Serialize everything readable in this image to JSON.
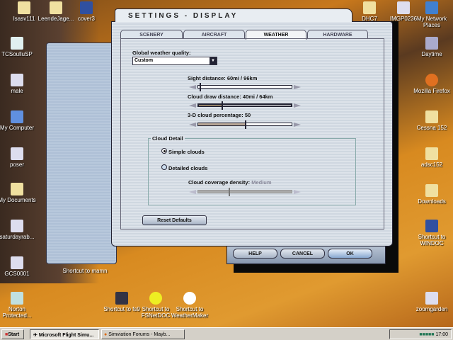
{
  "desktop": {
    "icons_left": [
      "Isasv111",
      "LeendeJage...",
      "cover3",
      "TCSoulluSP",
      "male",
      "My Computer",
      "poser",
      "My Documents",
      "saturdayrab...",
      "GCS0001",
      "Norton Protected..."
    ],
    "icons_bottom": [
      "Shortcut to fs9",
      "Shortcut to FSNetDOC",
      "Shortcut to WeatherMaker",
      "Shortcut to mamn"
    ],
    "icons_right": [
      "DHC7",
      "IMGP0236",
      "My Network Places",
      "Daytime",
      "Mozilla Firefox",
      "Cessna 152",
      "adsc152",
      "Downloads",
      "Shortcut to WINDOC",
      "zoomgarden"
    ]
  },
  "dialog": {
    "title": "SETTINGS - DISPLAY",
    "tabs": [
      {
        "label": "SCENERY"
      },
      {
        "label": "AIRCRAFT"
      },
      {
        "label": "WEATHER",
        "active": true
      },
      {
        "label": "HARDWARE"
      }
    ],
    "global_quality_label": "Global weather quality:",
    "global_quality_value": "Custom",
    "sight_label": "Sight distance: 60mi / 96km",
    "sight_value_pct": 2,
    "cloud_draw_label": "Cloud draw distance: 40mi / 64km",
    "cloud_draw_value_pct": 25,
    "cloud_pct_label": "3-D cloud percentage: 50",
    "cloud_pct_value": 50,
    "group_title": "Cloud Detail",
    "simple_clouds": "Simple clouds",
    "detailed_clouds": "Detailed clouds",
    "selected": "simple",
    "density_label": "Cloud coverage density:",
    "density_value": "Medium",
    "density_value_pct": 33,
    "reset": "Reset Defaults",
    "help": "HELP",
    "cancel": "CANCEL",
    "ok": "OK"
  },
  "taskbar": {
    "start": "Start",
    "tasks": [
      "Microsoft Flight Simu...",
      "Simviation Forums - Mayb..."
    ],
    "clock": "17:00"
  }
}
